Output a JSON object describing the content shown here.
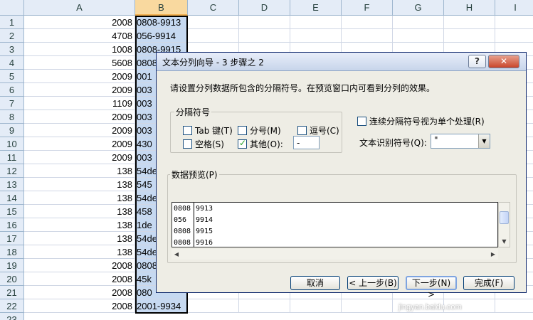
{
  "spreadsheet": {
    "columns": [
      "A",
      "B",
      "C",
      "D",
      "E",
      "F",
      "G",
      "H",
      "I"
    ],
    "rows": [
      {
        "num": "1",
        "a": "2008",
        "b": "0808-9913"
      },
      {
        "num": "2",
        "a": "4708",
        "b": "056-9914"
      },
      {
        "num": "3",
        "a": "1008",
        "b": "0808-9915"
      },
      {
        "num": "4",
        "a": "5608",
        "b": "0808"
      },
      {
        "num": "5",
        "a": "2009",
        "b": "001"
      },
      {
        "num": "6",
        "a": "2009",
        "b": "003"
      },
      {
        "num": "7",
        "a": "1109",
        "b": "003"
      },
      {
        "num": "8",
        "a": "2009",
        "b": "003"
      },
      {
        "num": "9",
        "a": "2009",
        "b": "003"
      },
      {
        "num": "10",
        "a": "2009",
        "b": "430"
      },
      {
        "num": "11",
        "a": "2009",
        "b": "003"
      },
      {
        "num": "12",
        "a": "138",
        "b": "54de"
      },
      {
        "num": "13",
        "a": "138",
        "b": "545"
      },
      {
        "num": "14",
        "a": "138",
        "b": "54de"
      },
      {
        "num": "15",
        "a": "138",
        "b": "458"
      },
      {
        "num": "16",
        "a": "138",
        "b": "1de"
      },
      {
        "num": "17",
        "a": "138",
        "b": "54de"
      },
      {
        "num": "18",
        "a": "138",
        "b": "54de"
      },
      {
        "num": "19",
        "a": "2008",
        "b": "0808"
      },
      {
        "num": "20",
        "a": "2008",
        "b": "45k"
      },
      {
        "num": "21",
        "a": "2008",
        "b": "080"
      },
      {
        "num": "22",
        "a": "2008",
        "b": "2001-9934"
      }
    ],
    "partial_row": "23"
  },
  "dialog": {
    "title": "文本分列向导 - 3 步骤之 2",
    "help_glyph": "?",
    "close_glyph": "✕",
    "instruction": "请设置分列数据所包含的分隔符号。在预览窗口内可看到分列的效果。",
    "delimiters": {
      "title": "分隔符号",
      "tab": {
        "label": "Tab 键(T)",
        "checked": false
      },
      "semicolon": {
        "label": "分号(M)",
        "checked": false
      },
      "comma": {
        "label": "逗号(C)",
        "checked": false
      },
      "space": {
        "label": "空格(S)",
        "checked": false
      },
      "other": {
        "label": "其他(O):",
        "checked": true,
        "value": "-"
      }
    },
    "consecutive": {
      "label": "连续分隔符号视为单个处理(R)",
      "checked": false
    },
    "qualifier": {
      "label": "文本识别符号(Q):",
      "value": "\""
    },
    "preview": {
      "title": "数据预览(P)",
      "rows": [
        [
          "0808",
          "9913"
        ],
        [
          "056",
          "9914"
        ],
        [
          "0808",
          "9915"
        ],
        [
          "0808",
          "9916"
        ]
      ]
    },
    "buttons": {
      "cancel": "取消",
      "back": "< 上一步(B)",
      "next": "下一步(N) >",
      "finish": "完成(F)"
    }
  },
  "watermark": "jingyan.baidu.com"
}
